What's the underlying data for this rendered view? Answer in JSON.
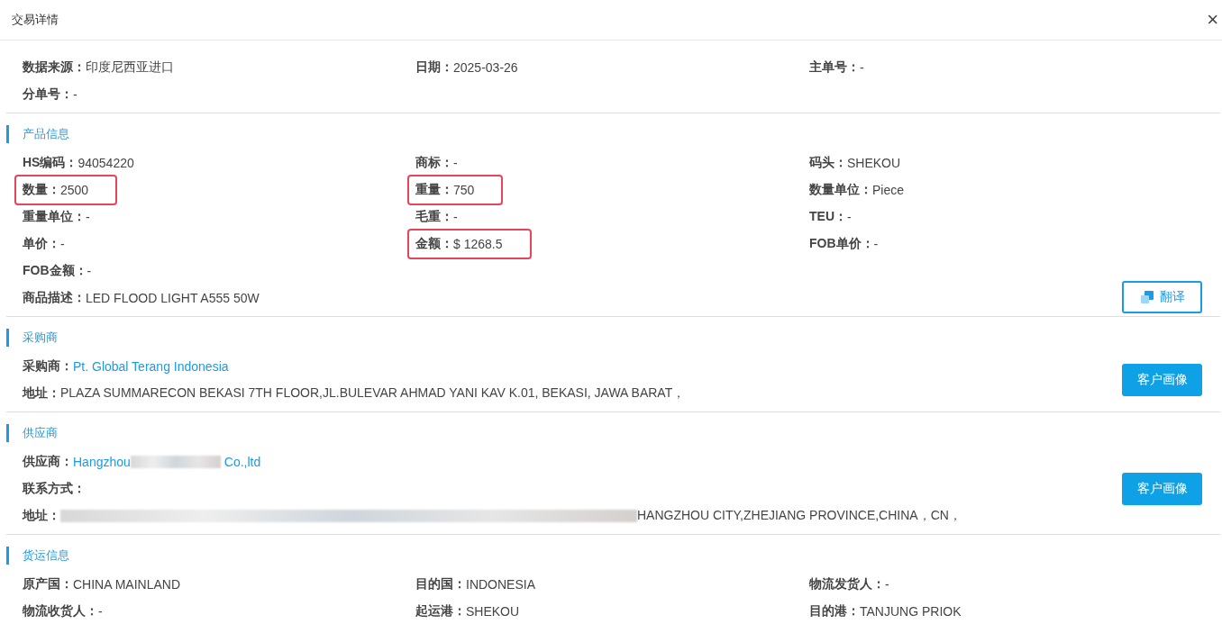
{
  "dialog": {
    "title": "交易详情",
    "close_icon": "×"
  },
  "sections": [
    {
      "fields": [
        {
          "text": "**数据来源：**印度尼西亚进口",
          "highlighted": false
        },
        {
          "text": "**日期：**2025-03-26",
          "highlighted": false
        },
        {
          "text": "**主单号：**-",
          "highlighted": false
        },
        {
          "text": "**分单号：**-",
          "highlighted": false
        }
      ]
    },
    {
      "title": "产品信息",
      "button": {
        "label": "翻译",
        "kind": "outline"
      },
      "fields": [
        {
          "text": "**HS编码：**94054220",
          "highlighted": false
        },
        {
          "text": "**商标：**-",
          "highlighted": false
        },
        {
          "text": "**码头：**SHEKOU",
          "highlighted": false
        },
        {
          "text": "**数量：**2500",
          "highlighted": true
        },
        {
          "text": "**重量：**750",
          "highlighted": true
        },
        {
          "text": "**数量单位：**Piece",
          "highlighted": false
        },
        {
          "text": "**重量单位：**-",
          "highlighted": false
        },
        {
          "text": "**毛重：**-",
          "highlighted": false
        },
        {
          "text": "**TEU：**-",
          "highlighted": false
        },
        {
          "text": "**单价：**-",
          "highlighted": false
        },
        {
          "text": "**金额：**$ 1268.5",
          "highlighted": true
        },
        {
          "text": "**FOB单价：**-",
          "highlighted": false
        },
        {
          "text": "**FOB金额：**-",
          "highlighted": false
        },
        {
          "text": "**商品描述：**LED FLOOD LIGHT A555 50W",
          "highlighted": false,
          "wide": true
        }
      ]
    },
    {
      "title": "采购商",
      "button": {
        "label": "客户画像",
        "kind": "primary"
      },
      "fields": [
        {
          "label": "采购商：",
          "value": "Pt. Global Terang Indonesia",
          "highlighted": false,
          "wide": true,
          "link": true
        },
        {
          "text": "**地址：**PLAZA SUMMARECON BEKASI 7TH FLOOR,JL.BULEVAR AHMAD YANI KAV K.01, BEKASI, JAWA BARAT，",
          "highlighted": false,
          "wide": true
        }
      ]
    },
    {
      "title": "供应商",
      "button": {
        "label": "客户画像",
        "kind": "primary"
      },
      "fields": [
        {
          "label": "供应商：",
          "value": "Hangzhou",
          "redacted": true,
          "value_after": "Co.,ltd",
          "highlighted": false,
          "wide": true,
          "link": true
        },
        {
          "text": "**联系方式：**",
          "highlighted": false,
          "wide": true
        },
        {
          "label": "地址：",
          "redacted": true,
          "value_after": "HANGZHOU CITY,ZHEJIANG PROVINCE,CHINA，CN，",
          "highlighted": false,
          "wide": true
        }
      ]
    },
    {
      "title": "货运信息",
      "fields": [
        {
          "text": "**原产国：**CHINA MAINLAND",
          "highlighted": false
        },
        {
          "text": "**目的国：**INDONESIA",
          "highlighted": false
        },
        {
          "text": "**物流发货人：**-",
          "highlighted": false
        },
        {
          "text": "**物流收货人：**-",
          "highlighted": false
        },
        {
          "text": "**起运港：**SHEKOU",
          "highlighted": false
        },
        {
          "text": "**目的港：**TANJUNG PRIOK",
          "highlighted": false
        }
      ]
    }
  ]
}
